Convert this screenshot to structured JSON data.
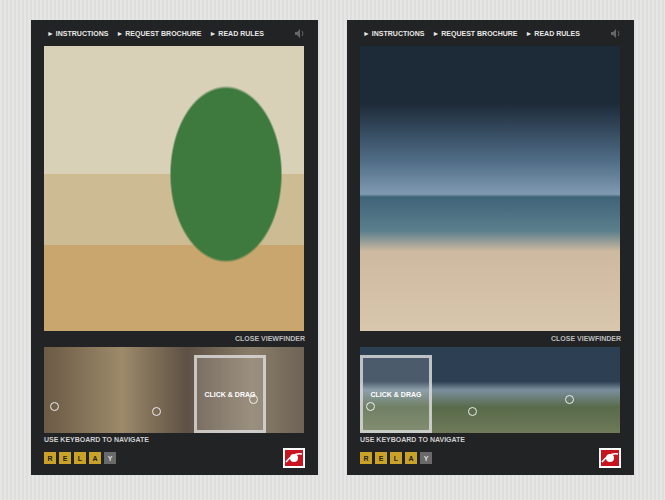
{
  "panels": [
    {
      "scene": "interior",
      "nav": [
        "► INSTRUCTIONS",
        "► REQUEST BROCHURE",
        "► READ RULES"
      ],
      "close": "CLOSE VIEWFINDER",
      "drag": "CLICK & DRAG",
      "keyboard": "USE KEYBOARD TO NAVIGATE",
      "keys": [
        {
          "label": "R",
          "lit": true
        },
        {
          "label": "E",
          "lit": true
        },
        {
          "label": "L",
          "lit": true
        },
        {
          "label": "A",
          "lit": true
        },
        {
          "label": "Y",
          "lit": false
        }
      ]
    },
    {
      "scene": "beach",
      "nav": [
        "► INSTRUCTIONS",
        "► REQUEST BROCHURE",
        "► READ RULES"
      ],
      "close": "CLOSE VIEWFINDER",
      "drag": "CLICK & DRAG",
      "keyboard": "USE KEYBOARD TO NAVIGATE",
      "keys": [
        {
          "label": "R",
          "lit": true
        },
        {
          "label": "E",
          "lit": true
        },
        {
          "label": "L",
          "lit": true
        },
        {
          "label": "A",
          "lit": true
        },
        {
          "label": "Y",
          "lit": false
        }
      ]
    }
  ]
}
